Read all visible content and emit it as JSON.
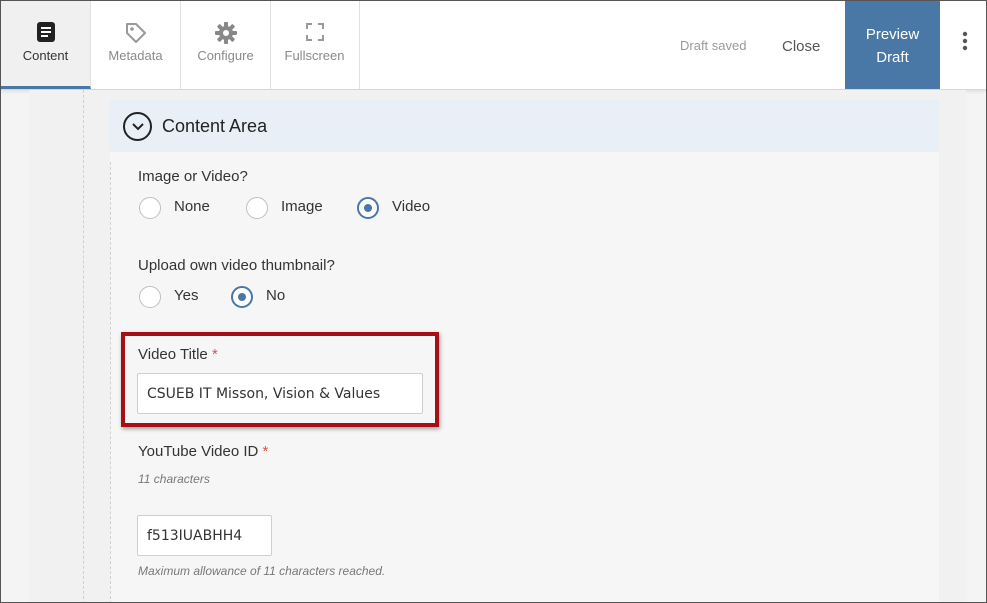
{
  "toolbar": {
    "tabs": [
      {
        "label": "Content",
        "icon": "document-icon",
        "active": true
      },
      {
        "label": "Metadata",
        "icon": "tag-icon",
        "active": false
      },
      {
        "label": "Configure",
        "icon": "gear-icon",
        "active": false
      },
      {
        "label": "Fullscreen",
        "icon": "fullscreen-icon",
        "active": false
      }
    ],
    "status": "Draft saved",
    "close_label": "Close",
    "preview_label_line1": "Preview",
    "preview_label_line2": "Draft",
    "more_icon": "vertical-ellipsis-icon"
  },
  "section": {
    "title": "Content Area",
    "toggle_icon": "chevron-down-circle-icon"
  },
  "form": {
    "media_type": {
      "label": "Image or Video?",
      "options": [
        "None",
        "Image",
        "Video"
      ],
      "selected": "Video"
    },
    "thumbnail": {
      "label": "Upload own video thumbnail?",
      "options": [
        "Yes",
        "No"
      ],
      "selected": "No"
    },
    "video_title": {
      "label": "Video Title",
      "required_mark": "*",
      "value": "CSUEB IT Misson, Vision & Values"
    },
    "youtube_id": {
      "label": "YouTube Video ID",
      "required_mark": "*",
      "hint": "11 characters",
      "value": "f513IUABHH4",
      "limit_note": "Maximum allowance of 11 characters reached."
    }
  },
  "colors": {
    "accent": "#4a78a6",
    "highlight": "#a50f15",
    "required": "#d9534f",
    "section_header_bg": "#e8eff7"
  }
}
